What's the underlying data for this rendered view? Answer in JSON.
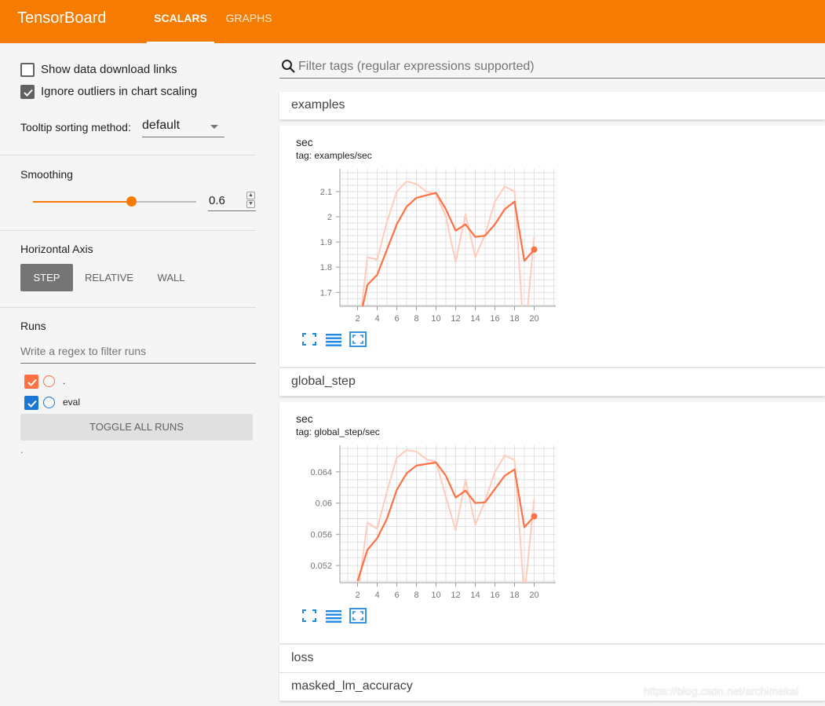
{
  "app": {
    "brand": "TensorBoard",
    "tabs": [
      {
        "label": "SCALARS",
        "active": true
      },
      {
        "label": "GRAPHS",
        "active": false
      }
    ],
    "accent_color": "#f57c00"
  },
  "sidebar": {
    "show_download_links": {
      "label": "Show data download links",
      "checked": false
    },
    "ignore_outliers": {
      "label": "Ignore outliers in chart scaling",
      "checked": true
    },
    "tooltip_sort": {
      "label": "Tooltip sorting method:",
      "value": "default"
    },
    "smoothing": {
      "label": "Smoothing",
      "value": "0.6",
      "fraction": 0.6
    },
    "horizontal_axis": {
      "label": "Horizontal Axis",
      "options": [
        "STEP",
        "RELATIVE",
        "WALL"
      ],
      "selected": "STEP"
    },
    "runs": {
      "label": "Runs",
      "filter_placeholder": "Write a regex to filter runs",
      "items": [
        {
          "name": ".",
          "checked": true,
          "color": "#ff7043"
        },
        {
          "name": "eval",
          "checked": true,
          "color": "#1976d2"
        }
      ],
      "toggle_all_label": "TOGGLE ALL RUNS",
      "footer_text": "."
    }
  },
  "main": {
    "filter_placeholder": "Filter tags (regular expressions supported)",
    "categories": [
      {
        "name": "examples"
      },
      {
        "name": "global_step"
      },
      {
        "name": "loss"
      },
      {
        "name": "masked_lm_accuracy"
      }
    ]
  },
  "watermark": "https://blog.csdn.net/archimekai",
  "chart_data": [
    {
      "type": "line",
      "title": "sec",
      "subtitle": "tag: examples/sec",
      "x_ticks": [
        2,
        4,
        6,
        8,
        10,
        12,
        14,
        16,
        18,
        20
      ],
      "y_ticks": [
        1.7,
        1.8,
        1.9,
        2,
        2.1
      ],
      "y_tick_labels": [
        "1.7",
        "1.8",
        "1.9",
        "2",
        "2.1"
      ],
      "xlim": [
        0.2,
        22.2
      ],
      "ylim": [
        1.645,
        2.19
      ],
      "grid": true,
      "series": [
        {
          "name": ".",
          "role": "raw",
          "color": "#ffccbc",
          "x": [
            2,
            3,
            4,
            5,
            6,
            7,
            8,
            9,
            10,
            11,
            12,
            13,
            14,
            15,
            16,
            17,
            18,
            19,
            20
          ],
          "y": [
            1.5,
            1.84,
            1.83,
            1.98,
            2.1,
            2.14,
            2.13,
            2.1,
            2.09,
            2.0,
            1.82,
            2.01,
            1.84,
            1.93,
            2.06,
            2.12,
            2.1,
            1.5,
            1.92
          ]
        },
        {
          "name": ".",
          "role": "smoothed",
          "color": "#ff7043",
          "x": [
            2,
            3,
            4,
            5,
            6,
            7,
            8,
            9,
            10,
            11,
            12,
            13,
            14,
            15,
            16,
            17,
            18,
            19,
            20
          ],
          "y": [
            1.55,
            1.73,
            1.77,
            1.87,
            1.97,
            2.04,
            2.075,
            2.085,
            2.095,
            2.03,
            1.945,
            1.97,
            1.92,
            1.925,
            1.97,
            2.03,
            2.06,
            1.825,
            1.87
          ]
        }
      ]
    },
    {
      "type": "line",
      "title": "sec",
      "subtitle": "tag: global_step/sec",
      "x_ticks": [
        2,
        4,
        6,
        8,
        10,
        12,
        14,
        16,
        18,
        20
      ],
      "y_ticks": [
        0.052,
        0.056,
        0.06,
        0.064
      ],
      "y_tick_labels": [
        "0.052",
        "0.056",
        "0.06",
        "0.064"
      ],
      "xlim": [
        0.2,
        22.2
      ],
      "ylim": [
        0.0498,
        0.0674
      ],
      "grid": true,
      "series": [
        {
          "name": ".",
          "role": "raw",
          "color": "#ffccbc",
          "x": [
            2,
            3,
            4,
            5,
            6,
            7,
            8,
            9,
            10,
            11,
            12,
            13,
            14,
            15,
            16,
            17,
            18,
            19,
            20
          ],
          "y": [
            0.048,
            0.0575,
            0.0567,
            0.0615,
            0.0658,
            0.0668,
            0.0666,
            0.0656,
            0.0653,
            0.0608,
            0.0565,
            0.063,
            0.0572,
            0.0603,
            0.064,
            0.0661,
            0.0655,
            0.048,
            0.0605
          ]
        },
        {
          "name": ".",
          "role": "smoothed",
          "color": "#ff7043",
          "x": [
            2,
            3,
            4,
            5,
            6,
            7,
            8,
            9,
            10,
            11,
            12,
            13,
            14,
            15,
            16,
            17,
            18,
            19,
            20
          ],
          "y": [
            0.05,
            0.054,
            0.0555,
            0.058,
            0.0617,
            0.0638,
            0.0648,
            0.065,
            0.0652,
            0.0635,
            0.0607,
            0.0616,
            0.06,
            0.0601,
            0.0618,
            0.0635,
            0.0643,
            0.0569,
            0.0583
          ]
        }
      ]
    }
  ]
}
